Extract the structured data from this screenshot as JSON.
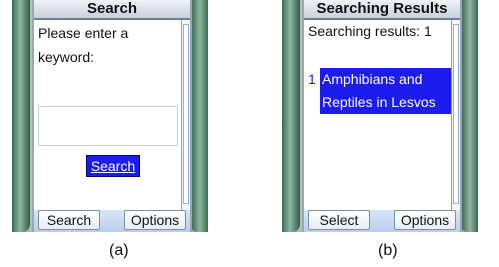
{
  "panel_a": {
    "title": "Search",
    "prompt": "Please enter a keyword:",
    "input_value": "",
    "search_button": "Search",
    "softkey_left": "Search",
    "softkey_right": "Options",
    "caption": "(a)"
  },
  "panel_b": {
    "title": "Searching Results",
    "results_count": "Searching results: 1",
    "results": [
      {
        "num": "1",
        "title": "Amphibians and Reptiles in Lesvos"
      }
    ],
    "softkey_left": "Select",
    "softkey_right": "Options",
    "caption": "(b)"
  },
  "colors": {
    "highlight": "#1c1cf0",
    "softbar": "#c7d9f2",
    "rail": "#3d6b56"
  }
}
